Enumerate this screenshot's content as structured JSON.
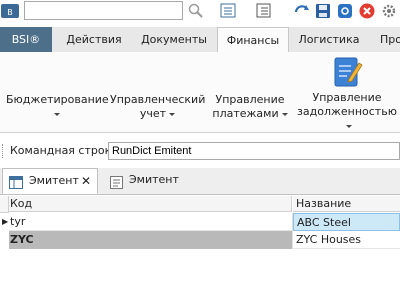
{
  "toolbar": {
    "search_value": "",
    "icons": [
      "logo-icon",
      "search-icon",
      "list-view-icon",
      "numbered-list-icon",
      "refresh-icon",
      "save-icon",
      "sync-icon",
      "close-icon",
      "settings-icon"
    ]
  },
  "ribbon_tabs": {
    "bsi": "BSI®",
    "actions": "Действия",
    "documents": "Документы",
    "finance": "Финансы",
    "logistics": "Логистика",
    "more": "Про"
  },
  "ribbon": {
    "budgeting": "Бюджетирование",
    "mgmt_accounting_1": "Управленческий",
    "mgmt_accounting_2": "учет",
    "payments_1": "Управление",
    "payments_2": "платежами",
    "debts_1": "Управление",
    "debts_2": "задолженностью"
  },
  "command": {
    "label": "Командная строка",
    "value": "RunDict Emitent"
  },
  "doc_tabs": [
    {
      "label": "Эмитент"
    },
    {
      "label": "Эмитент"
    }
  ],
  "grid": {
    "columns": [
      "Код",
      "Название"
    ],
    "rows": [
      [
        "tyr",
        "ABC Steel"
      ],
      [
        "ZYC",
        "ZYC Houses"
      ]
    ]
  },
  "colors": {
    "accent": "#4d6f8a",
    "selected_row": "#cde8f7",
    "gray_row": "#b9b9b9"
  }
}
